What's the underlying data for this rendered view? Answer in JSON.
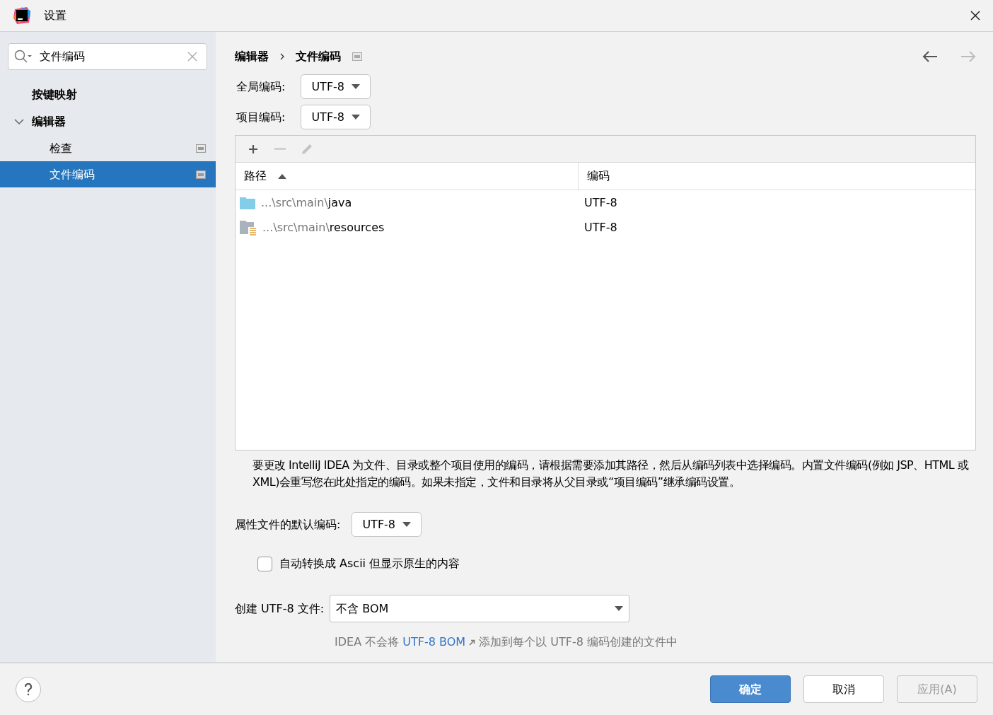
{
  "window": {
    "title": "设置"
  },
  "search": {
    "value": "文件编码"
  },
  "sidebar": {
    "items": [
      {
        "label": "按键映射",
        "selected": false
      },
      {
        "label": "编辑器",
        "expanded": true,
        "selected": false,
        "children": [
          {
            "label": "检查",
            "selected": false,
            "project_icon": true
          },
          {
            "label": "文件编码",
            "selected": true,
            "project_icon": true
          }
        ]
      }
    ]
  },
  "breadcrumb": [
    "编辑器",
    "文件编码"
  ],
  "nav": {
    "back_disabled": false,
    "forward_disabled": true
  },
  "global_encoding": {
    "label": "全局编码:",
    "value": "UTF-8"
  },
  "project_encoding": {
    "label": "项目编码:",
    "value": "UTF-8"
  },
  "toolbar": [
    {
      "kind": "add",
      "disabled": false
    },
    {
      "kind": "remove",
      "disabled": true
    },
    {
      "kind": "edit",
      "disabled": true
    }
  ],
  "table": {
    "columns": [
      {
        "label": "路径",
        "sorted_asc": true
      },
      {
        "label": "编码",
        "sorted_asc": false
      }
    ],
    "rows": [
      {
        "kind": "source",
        "path_prefix": "...\\src\\main\\",
        "path_name": "java",
        "encoding": "UTF-8"
      },
      {
        "kind": "resources",
        "path_prefix": "...\\src\\main\\",
        "path_name": "resources",
        "encoding": "UTF-8"
      }
    ]
  },
  "description": "要更改 IntelliJ IDEA 为文件、目录或整个项目使用的编码，请根据需要添加其路径，然后从编码列表中选择编码。内置文件编码(例如 JSP、HTML 或 XML)会重写您在此处指定的编码。如果未指定，文件和目录将从父目录或“项目编码”继承编码设置。",
  "properties_encoding": {
    "label": "属性文件的默认编码:",
    "value": "UTF-8"
  },
  "ascii_checkbox": {
    "label": "自动转换成 Ascii 但显示原生的内容",
    "checked": false
  },
  "bom": {
    "label": "创建 UTF-8 文件:",
    "value": "不含 BOM",
    "hint_before": "IDEA 不会将",
    "hint_link": "UTF-8 BOM",
    "hint_after": "添加到每个以 UTF-8 编码创建的文件中"
  },
  "buttons": [
    {
      "label": "确定",
      "kind": "primary",
      "disabled": false
    },
    {
      "label": "取消",
      "kind": "secondary",
      "disabled": false
    },
    {
      "label": "应用(A)",
      "kind": "secondary",
      "disabled": true
    }
  ]
}
